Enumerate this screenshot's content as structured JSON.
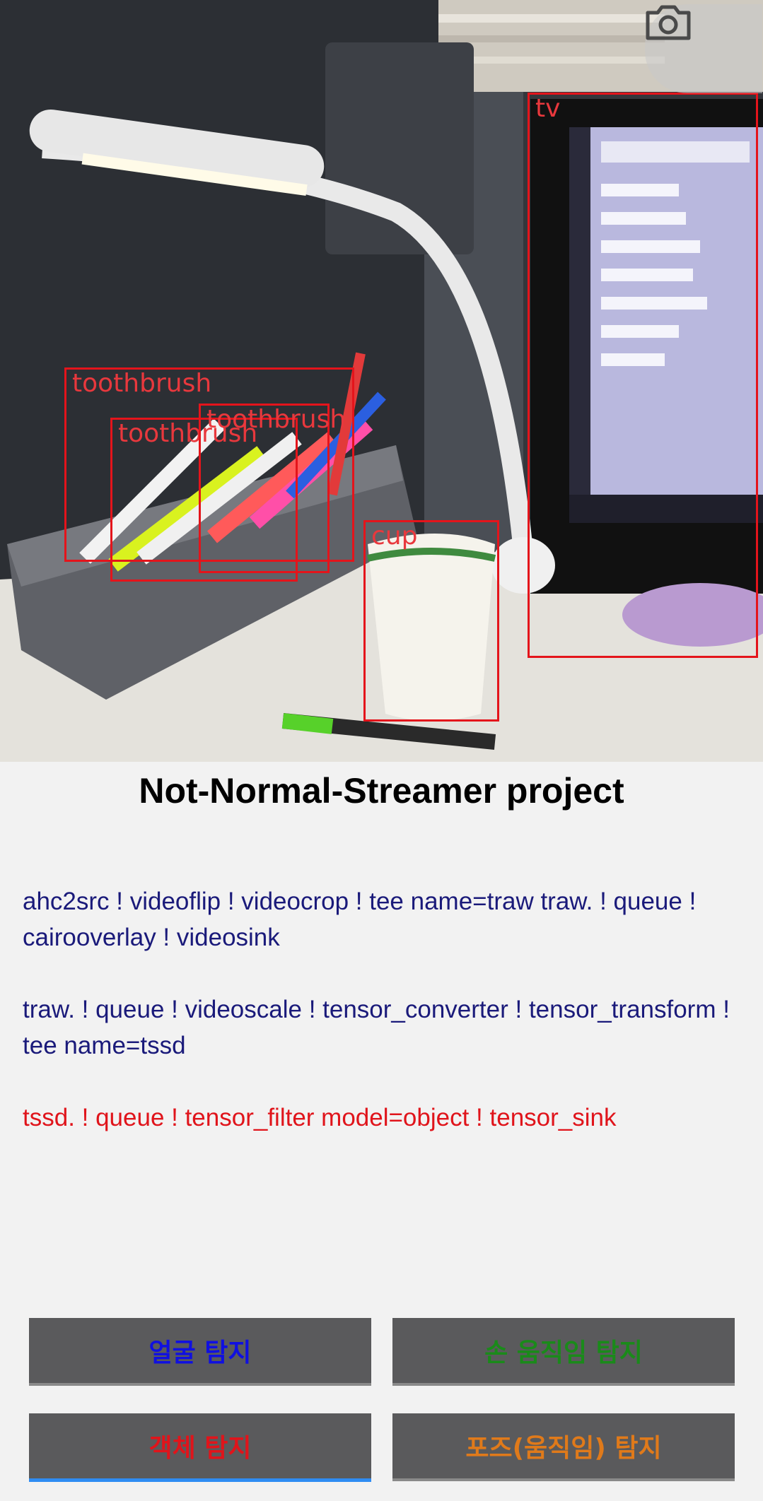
{
  "camera": {
    "detections": [
      {
        "label": "tv"
      },
      {
        "label": "toothbrush"
      },
      {
        "label": "toothbrush"
      },
      {
        "label": "toothbrush"
      },
      {
        "label": "cup"
      }
    ],
    "capture_icon": "camera-icon"
  },
  "title": "Not-Normal-Streamer project",
  "pipeline": {
    "line1": "ahc2src ! videoflip ! videocrop ! tee name=traw traw. ! queue ! cairooverlay ! videosink",
    "line2": "traw. ! queue ! videoscale ! tensor_converter ! tensor_transform ! tee name=tssd",
    "line3": "tssd. ! queue ! tensor_filter model=object ! tensor_sink"
  },
  "buttons": {
    "face": "얼굴 탐지",
    "hand": "손 움직임 탐지",
    "object": "객체 탐지",
    "pose": "포즈(움직임) 탐지"
  },
  "colors": {
    "face": "#1010e0",
    "hand": "#1a8a1a",
    "object": "#e0141b",
    "pose": "#e07a1a",
    "box": "#e4141b"
  }
}
